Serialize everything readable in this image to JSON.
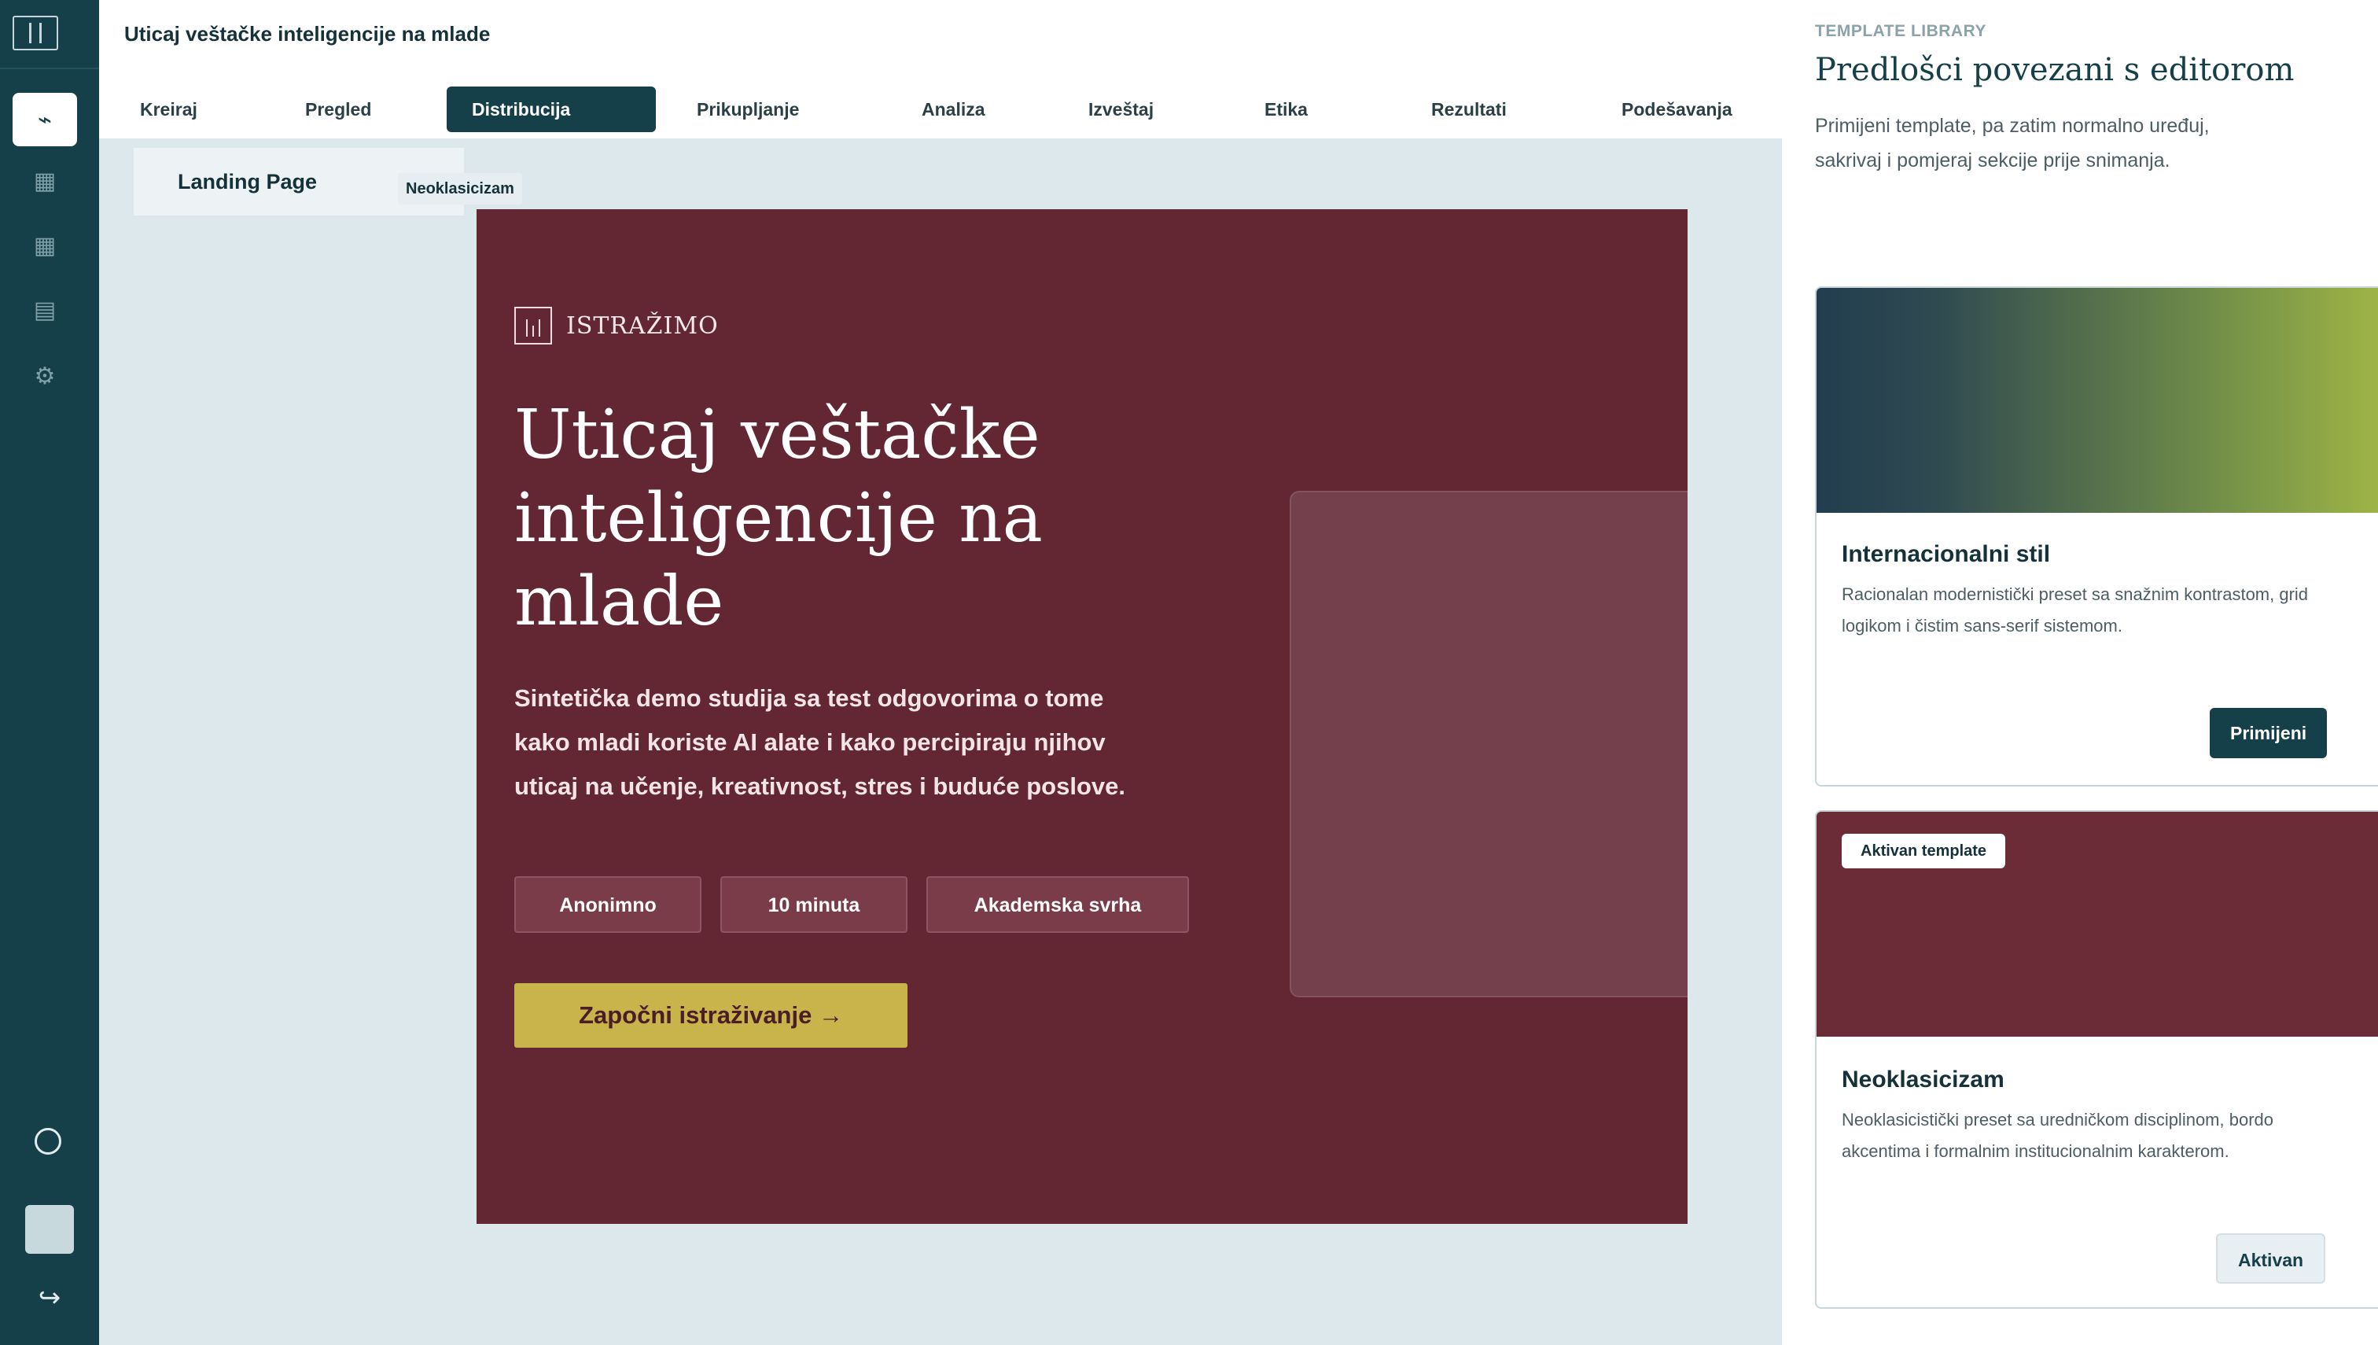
{
  "app": {
    "document_title": "Uticaj veštačke inteligencije na mlade"
  },
  "tabs": [
    {
      "label": "Kreiraj"
    },
    {
      "label": "Pregled"
    },
    {
      "label": "Distribucija"
    },
    {
      "label": "Prikupljanje"
    },
    {
      "label": "Analiza"
    },
    {
      "label": "Izveštaj"
    },
    {
      "label": "Etika"
    },
    {
      "label": "Rezultati"
    },
    {
      "label": "Podešavanja"
    }
  ],
  "active_tab": "Distribucija",
  "rail": {
    "icons": [
      "lightning-icon",
      "grid-icon",
      "grid-icon",
      "list-icon",
      "gear-icon"
    ],
    "active_icon": "lightning-icon",
    "glyphs": {
      "active": "⌁",
      "grid": "▦",
      "list": "▤",
      "gear": "⚙",
      "logout": "↪"
    }
  },
  "editor": {
    "page_label": "Landing Page",
    "template_chip": "Neoklasicizam"
  },
  "hero": {
    "brand": "ISTRAŽIMO",
    "title": "Uticaj veštačke inteligencije na mlade",
    "subtitle": "Sintetička demo studija sa test odgovorima o tome kako mladi koriste AI alate i kako percipiraju njihov uticaj na učenje, kreativnost, stres i buduće poslove.",
    "pills": [
      "Anonimno",
      "10 minuta",
      "Akademska svrha"
    ],
    "cta": "Započni istraživanje →",
    "colors": {
      "background": "#632734",
      "cta": "#c9b34b"
    }
  },
  "panel": {
    "eyebrow": "TEMPLATE LIBRARY",
    "title": "Predlošci povezani s editorom",
    "description": "Primijeni template, pa zatim normalno uređuj, sakrivaj i pomjeraj sekcije prije snimanja.",
    "templates": [
      {
        "name": "Internacionalni stil",
        "description": "Racionalan modernistički preset sa snažnim kontrastom, grid logikom i čistim sans-serif sistemom.",
        "button": "Primijeni",
        "preview_colors": [
          "#223d4f",
          "#a9bb45"
        ]
      },
      {
        "badge": "Aktivan template",
        "name": "Neoklasicizam",
        "description": "Neoklasicistički preset sa uredničkom disciplinom, bordo akcentima i formalnim institucionalnim karakterom.",
        "button": "Aktivan",
        "preview_colors": [
          "#6b2c37"
        ]
      }
    ]
  }
}
